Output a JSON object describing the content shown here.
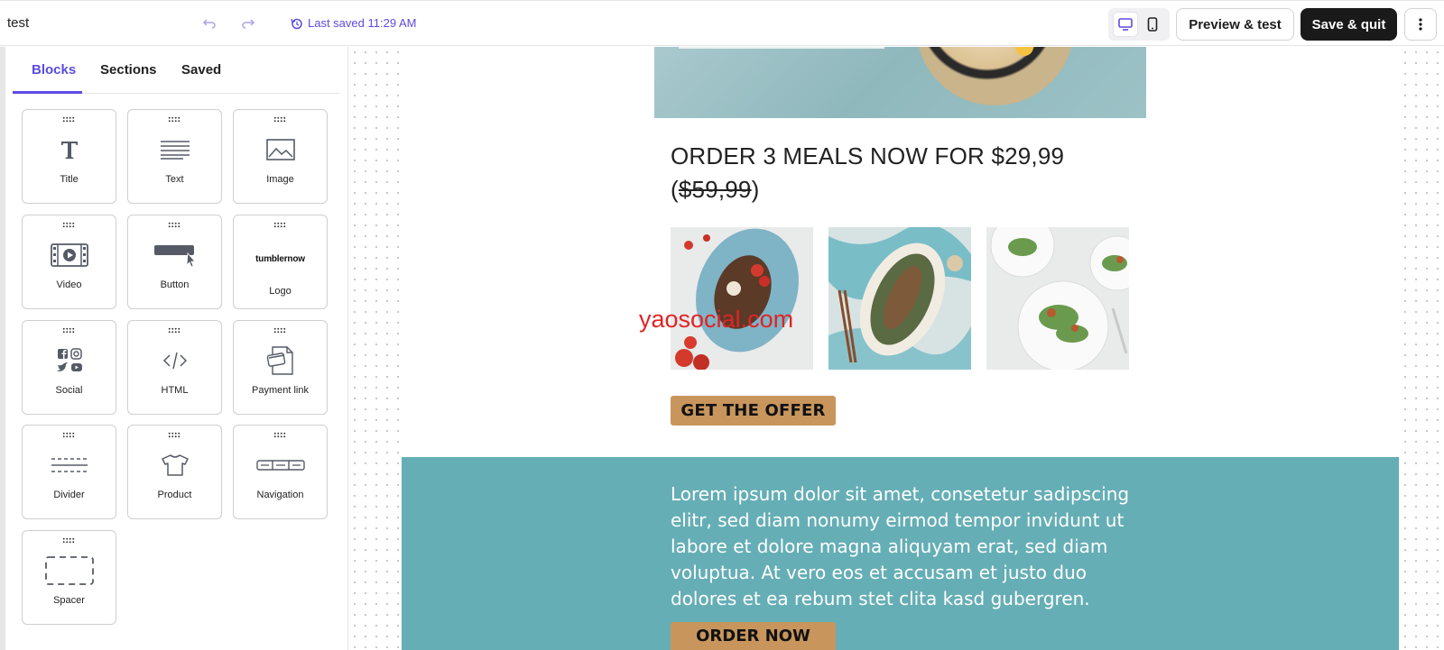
{
  "header": {
    "doc_title": "test",
    "last_saved": "Last saved 11:29 AM",
    "preview_label": "Preview & test",
    "save_label": "Save & quit",
    "icons": [
      "undo-icon",
      "redo-icon",
      "history-icon",
      "desktop-icon",
      "mobile-icon",
      "more-vertical-icon"
    ]
  },
  "sidebar": {
    "tabs": [
      "Blocks",
      "Sections",
      "Saved"
    ],
    "active_tab": "Blocks",
    "blocks": [
      {
        "label": "Title",
        "icon": "title-icon"
      },
      {
        "label": "Text",
        "icon": "text-icon"
      },
      {
        "label": "Image",
        "icon": "image-icon"
      },
      {
        "label": "Video",
        "icon": "video-icon"
      },
      {
        "label": "Button",
        "icon": "button-icon"
      },
      {
        "label": "Logo",
        "icon": "logo-icon",
        "logo_text": "tumblernow"
      },
      {
        "label": "Social",
        "icon": "social-icon"
      },
      {
        "label": "HTML",
        "icon": "code-icon"
      },
      {
        "label": "Payment link",
        "icon": "payment-icon"
      },
      {
        "label": "Divider",
        "icon": "divider-icon"
      },
      {
        "label": "Product",
        "icon": "shirt-icon"
      },
      {
        "label": "Navigation",
        "icon": "navigation-icon"
      },
      {
        "label": "Spacer",
        "icon": "spacer-icon"
      }
    ]
  },
  "email": {
    "headline_main": "ORDER 3 MEALS NOW FOR $29,99",
    "headline_old_open": "(",
    "headline_old_price": "$59,99",
    "headline_old_close": ")",
    "offer_button": "GET THE OFFER",
    "body_text": "Lorem ipsum dolor sit amet, consetetur sadipscing elitr, sed diam nonumy eirmod tempor invidunt ut labore et dolore magna aliquyam erat, sed diam voluptua. At vero eos et accusam et justo duo dolores et ea rebum stet clita kasd gubergren.",
    "order_button": "ORDER NOW"
  },
  "watermark": "yaosocial.com",
  "colors": {
    "accent": "#5b4ce0",
    "dark_button": "#1a1a1a",
    "cta_button": "#c8955c",
    "teal_section": "#65aeb5",
    "watermark": "#e02424"
  }
}
